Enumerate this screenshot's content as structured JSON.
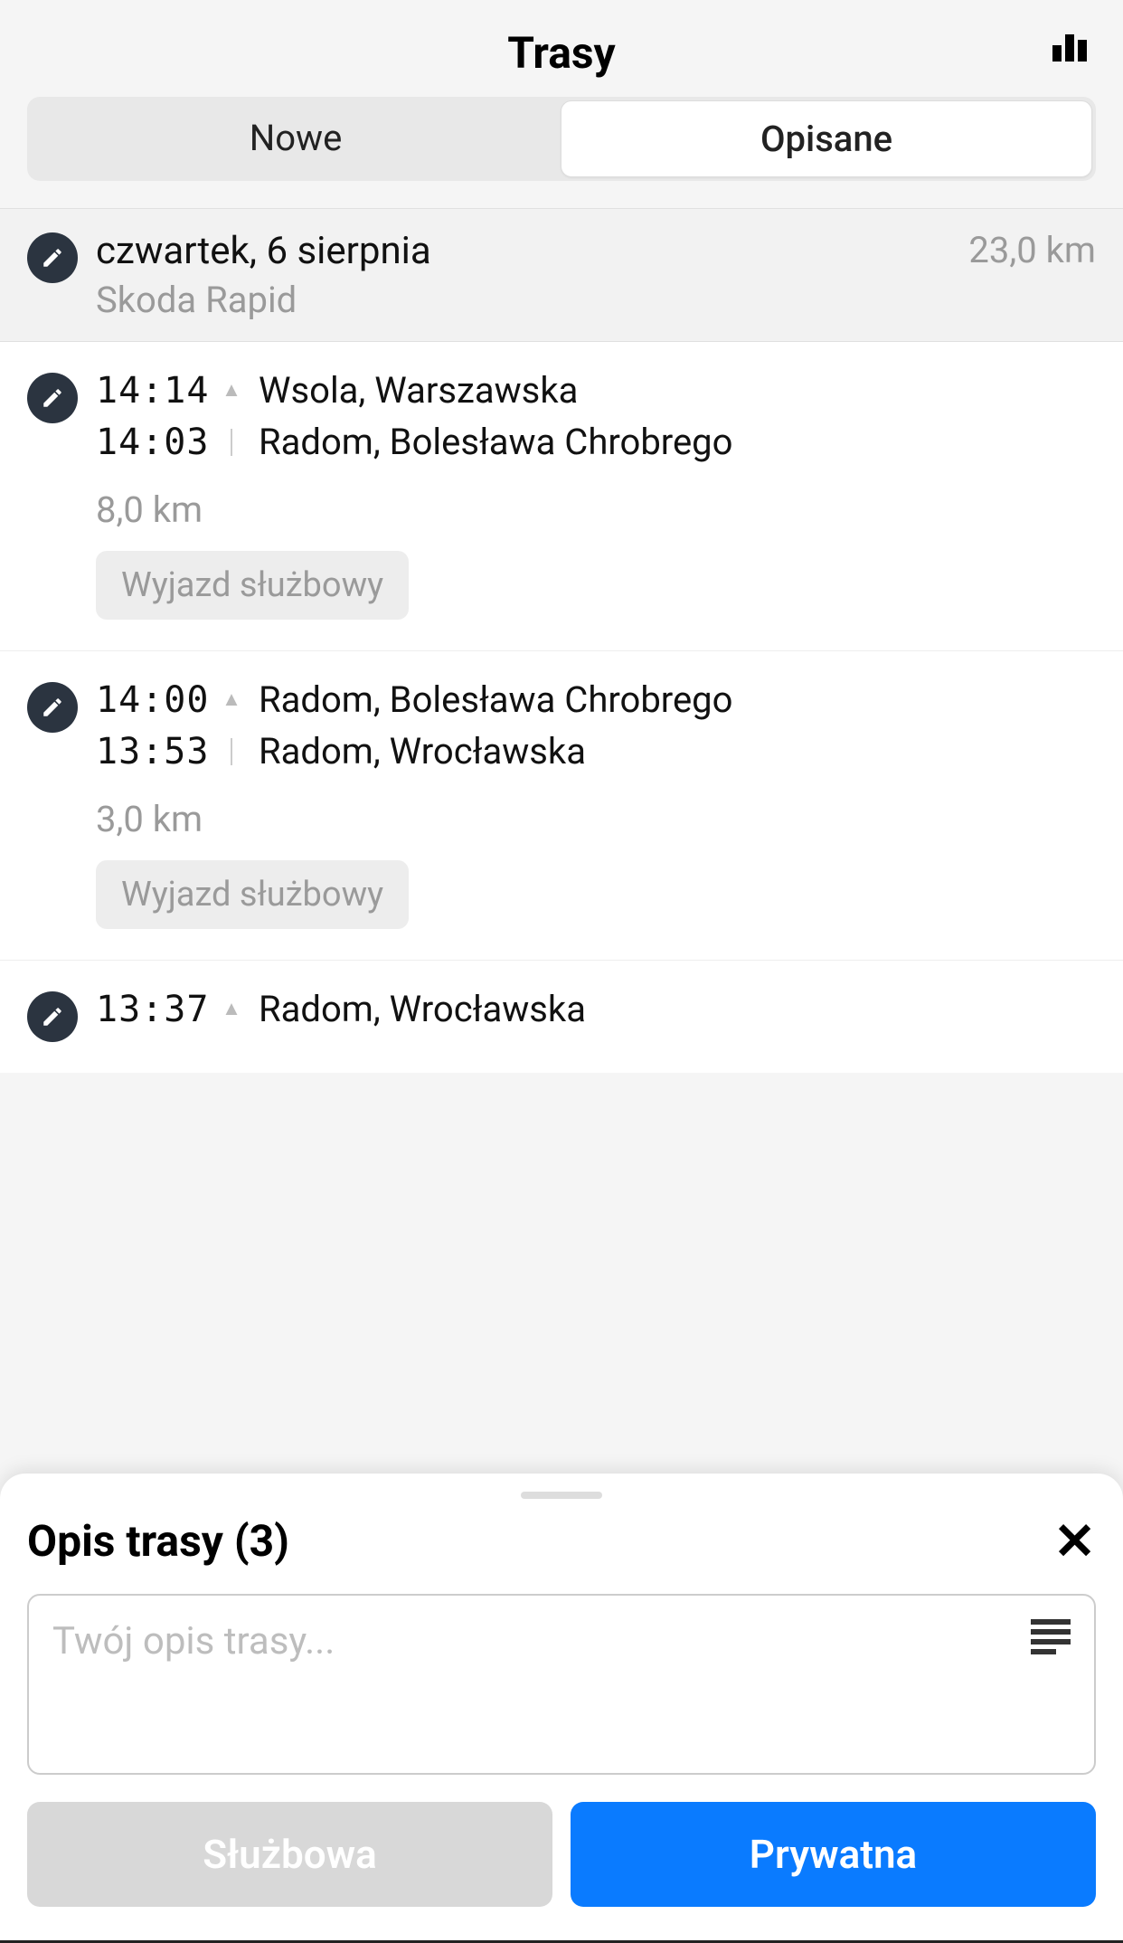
{
  "header": {
    "title": "Trasy"
  },
  "tabs": {
    "left": "Nowe",
    "right": "Opisane"
  },
  "day": {
    "date": "czwartek, 6 sierpnia",
    "vehicle": "Skoda Rapid",
    "total_km": "23,0 km"
  },
  "trips": [
    {
      "time_end": "14:14",
      "place_end": "Wsola, Warszawska",
      "time_start": "14:03",
      "place_start": "Radom, Bolesława Chrobrego",
      "distance": "8,0 km",
      "tag": "Wyjazd służbowy"
    },
    {
      "time_end": "14:00",
      "place_end": "Radom, Bolesława Chrobrego",
      "time_start": "13:53",
      "place_start": "Radom, Wrocławska",
      "distance": "3,0 km",
      "tag": "Wyjazd służbowy"
    },
    {
      "time_end": "13:37",
      "place_end": "Radom, Wrocławska",
      "time_start": "",
      "place_start": "",
      "distance": "",
      "tag": ""
    }
  ],
  "sheet": {
    "title": "Opis trasy (3)",
    "placeholder": "Twój opis trasy...",
    "btn_business": "Służbowa",
    "btn_private": "Prywatna"
  }
}
